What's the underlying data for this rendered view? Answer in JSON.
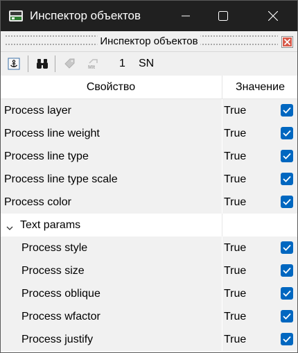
{
  "window": {
    "title": "Инспектор объектов"
  },
  "panel": {
    "title": "Инспектор объектов"
  },
  "toolbar": {
    "count": "1",
    "mode": "SN"
  },
  "grid": {
    "col_property": "Свойство",
    "col_value": "Значение",
    "rows": [
      {
        "label": "Process layer",
        "value": "True",
        "checked": true
      },
      {
        "label": "Process line weight",
        "value": "True",
        "checked": true
      },
      {
        "label": "Process line type",
        "value": "True",
        "checked": true
      },
      {
        "label": "Process line type scale",
        "value": "True",
        "checked": true
      },
      {
        "label": "Process color",
        "value": "True",
        "checked": true
      }
    ],
    "group": {
      "label": "Text params",
      "expanded": true,
      "rows": [
        {
          "label": "Process style",
          "value": "True",
          "checked": true
        },
        {
          "label": "Process size",
          "value": "True",
          "checked": true
        },
        {
          "label": "Process oblique",
          "value": "True",
          "checked": true
        },
        {
          "label": "Process wfactor",
          "value": "True",
          "checked": true
        },
        {
          "label": "Process justify",
          "value": "True",
          "checked": true
        }
      ]
    }
  },
  "colors": {
    "titlebar": "#202020",
    "accent": "#0067c0",
    "close_red": "#c42b1c"
  },
  "icons": [
    "app-icon",
    "minimize-icon",
    "maximize-icon",
    "close-icon",
    "panel-close-icon",
    "anchor-icon",
    "binoculars-icon",
    "tag-icon",
    "match-properties-icon",
    "chevron-down-icon",
    "checkbox-icon"
  ]
}
